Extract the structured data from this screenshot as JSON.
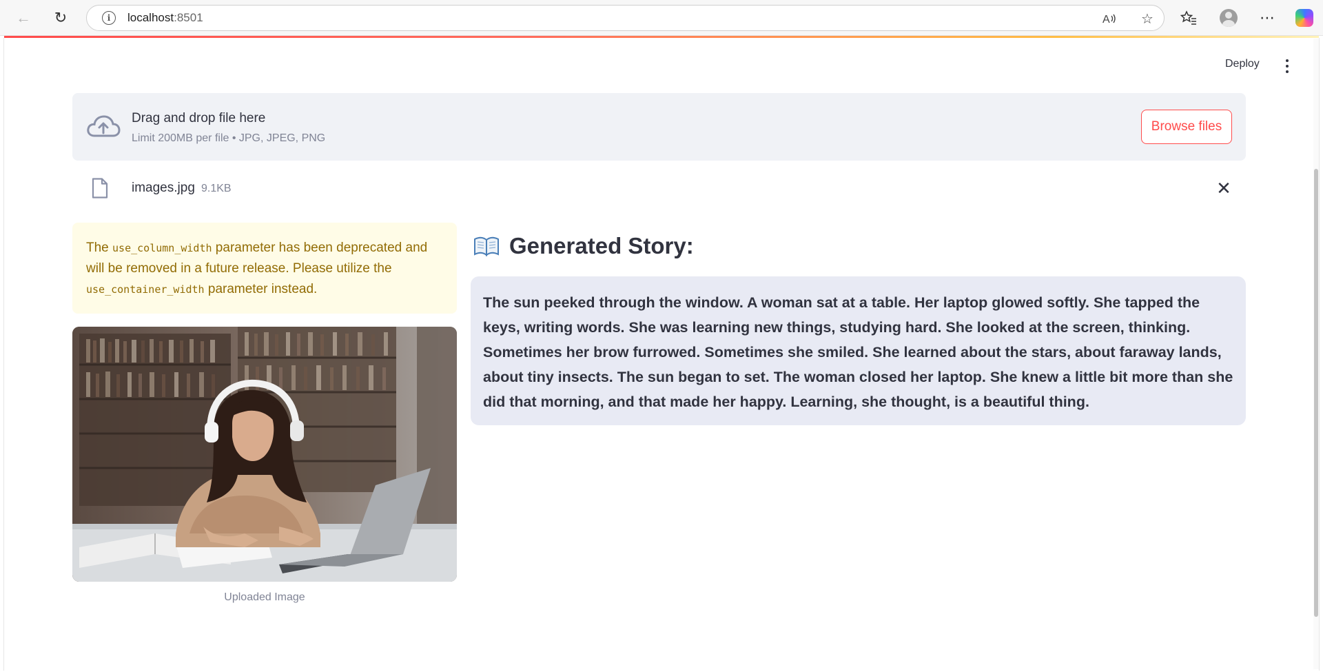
{
  "browser": {
    "url_host": "localhost",
    "url_port": ":8501"
  },
  "app_header": {
    "deploy_label": "Deploy"
  },
  "uploader": {
    "title": "Drag and drop file here",
    "subtitle": "Limit 200MB per file • JPG, JPEG, PNG",
    "browse_label": "Browse files"
  },
  "uploaded_file": {
    "name": "images.jpg",
    "size": "9.1KB"
  },
  "warning": {
    "part1": "The ",
    "code1": "use_column_width",
    "part2": " parameter has been deprecated and will be removed in a future release. Please utilize the ",
    "code2": "use_container_width",
    "part3": " parameter instead."
  },
  "image": {
    "caption": "Uploaded Image"
  },
  "story": {
    "heading": "Generated Story:",
    "text": "The sun peeked through the window. A woman sat at a table. Her laptop glowed softly. She tapped the keys, writing words. She was learning new things, studying hard. She looked at the screen, thinking. Sometimes her brow furrowed. Sometimes she smiled. She learned about the stars, about faraway lands, about tiny insects. The sun began to set. The woman closed her laptop. She knew a little bit more than she did that morning, and that made her happy. Learning, she thought, is a beautiful thing."
  },
  "colors": {
    "accent": "#ff4b4b",
    "warning_bg": "#fffce7",
    "warning_text": "#926c05",
    "story_bg": "#e8eaf4"
  }
}
